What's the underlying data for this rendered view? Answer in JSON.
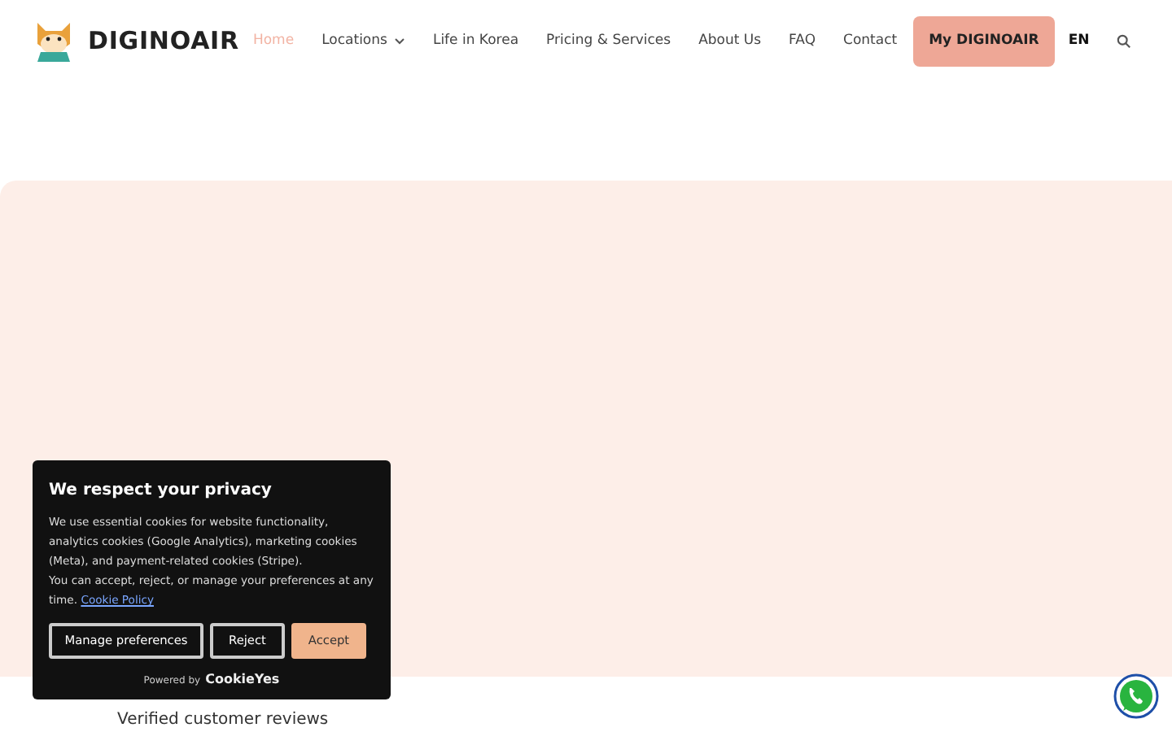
{
  "brand": {
    "name": "DIGINOAIR"
  },
  "nav": [
    {
      "label": "Home",
      "selected": true,
      "dropdown": false
    },
    {
      "label": "Locations",
      "selected": false,
      "dropdown": true
    },
    {
      "label": "Life in Korea",
      "selected": false,
      "dropdown": false
    },
    {
      "label": "Pricing & Services",
      "selected": false,
      "dropdown": false
    },
    {
      "label": "About Us",
      "selected": false,
      "dropdown": false
    },
    {
      "label": "FAQ",
      "selected": false,
      "dropdown": false
    },
    {
      "label": "Contact",
      "selected": false,
      "dropdown": false
    }
  ],
  "account_button": "My DIGINOAIR",
  "language": "EN",
  "below_text": "Verified customer reviews",
  "cookie_banner": {
    "title": "We respect your privacy",
    "text": "We use essential cookies for website functionality, analytics cookies (Google Analytics), marketing cookies (Meta), and payment-related cookies (Stripe).",
    "text2": "You can accept, reject, or manage your preferences at any time.",
    "link": "Cookie Policy",
    "buttons": [
      {
        "label": "Manage preferences",
        "kind": "outline"
      },
      {
        "label": "Reject",
        "kind": "outline"
      },
      {
        "label": "Accept",
        "kind": "primary"
      }
    ],
    "powered_by": "Powered by",
    "powered_brand": "CookieYes"
  }
}
